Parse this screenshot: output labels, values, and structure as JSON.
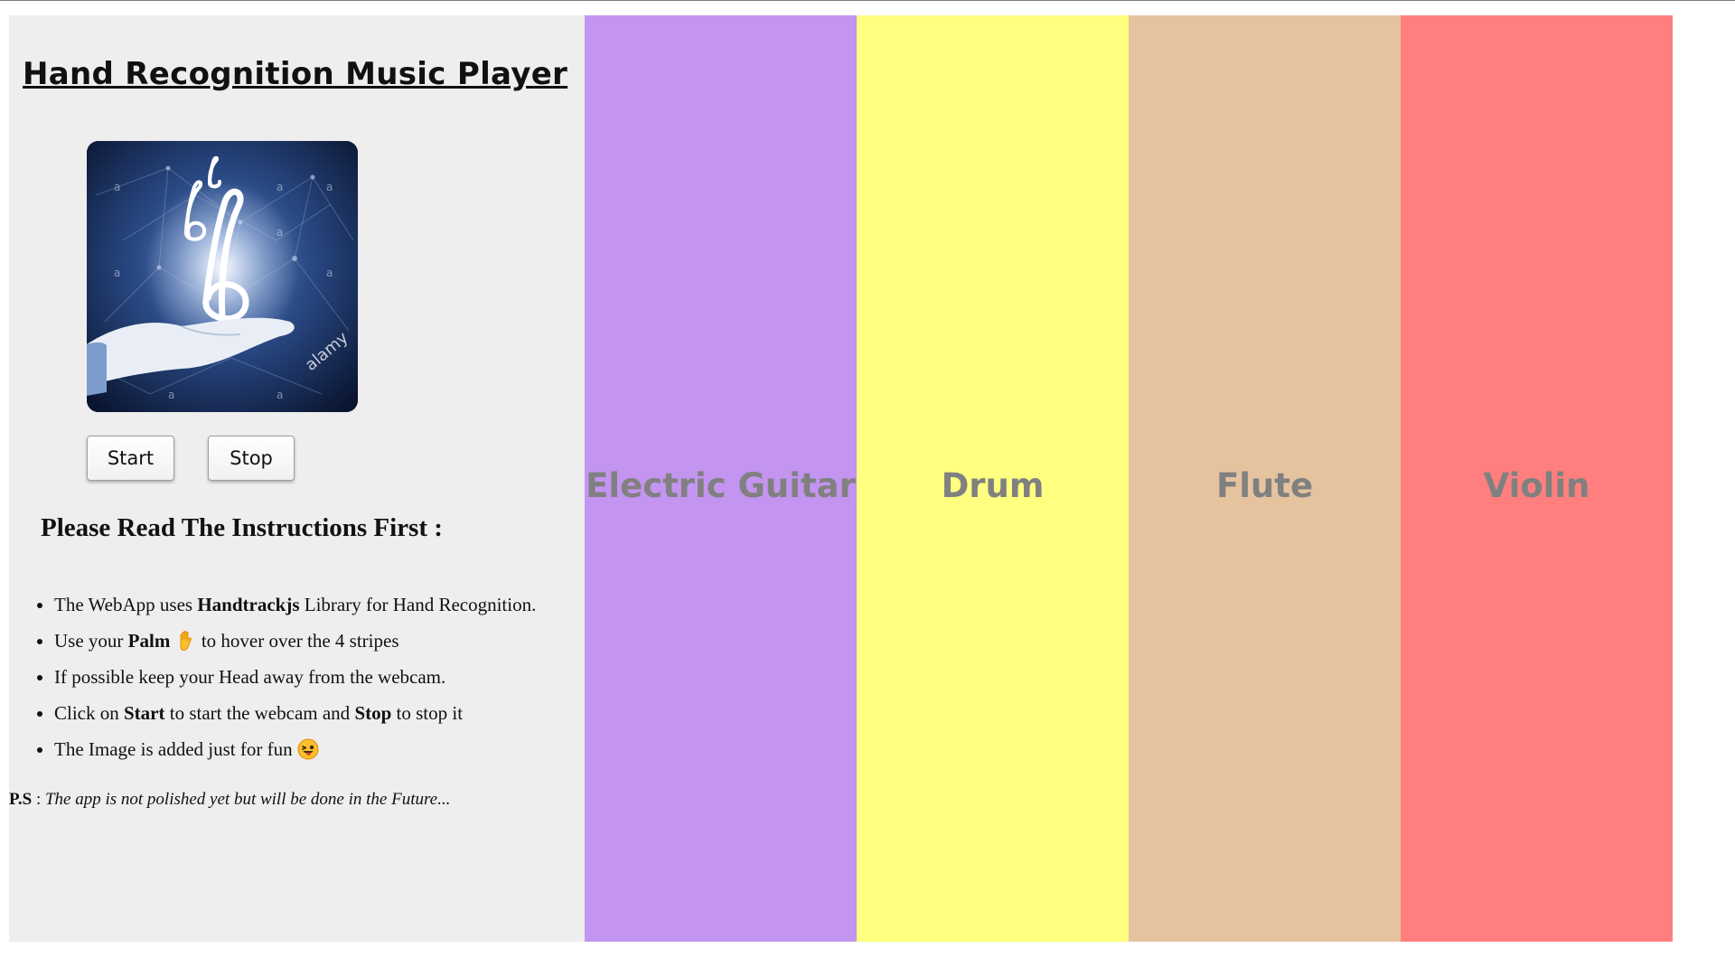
{
  "app": {
    "title": "Hand Recognition Music Player"
  },
  "hero_image": {
    "watermark": "alamy",
    "watermark_mark": "a"
  },
  "controls": {
    "start_label": "Start",
    "stop_label": "Stop"
  },
  "instructions": {
    "heading": "Please Read The Instructions First :",
    "items": [
      {
        "pre": "The WebApp uses ",
        "bold": "Handtrackjs",
        "post": " Library for Hand Recognition."
      },
      {
        "pre": "Use your ",
        "bold": "Palm",
        "icon": "raised-hand-emoji-icon",
        "post": " to hover over the 4 stripes"
      },
      {
        "text": "If possible keep your Head away from the webcam."
      },
      {
        "pre": "Click on ",
        "bold": "Start",
        "mid": " to start the webcam and ",
        "bold2": "Stop",
        "post": " to stop it"
      },
      {
        "text": "The Image is added just for fun",
        "icon": "tongue-out-emoji-icon"
      }
    ]
  },
  "footnote": {
    "label": "P.S",
    "separator": " : ",
    "text": "The app is not polished yet but will be done in the Future..."
  },
  "stripes": [
    {
      "label": "Electric Guitar",
      "color": "#c394f0"
    },
    {
      "label": "Drum",
      "color": "#ffff80"
    },
    {
      "label": "Flute",
      "color": "#e5c39f"
    },
    {
      "label": "Violin",
      "color": "#ff7f7f"
    }
  ],
  "colors": {
    "panel_bg": "#eeeeee",
    "stripe_text": "#808080"
  }
}
